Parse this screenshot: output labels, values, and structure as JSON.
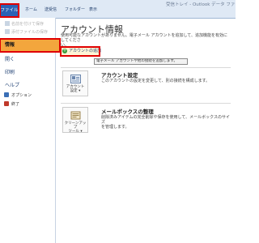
{
  "ribbon": {
    "file_tab": "ファイル",
    "tabs": [
      "ホーム",
      "送受信",
      "フォルダー",
      "表示"
    ],
    "window_title": "受信トレイ - Outlook データ ファイ"
  },
  "sidebar": {
    "commands": [
      "名前を付けて保存",
      "添付ファイルの保存"
    ],
    "nav": [
      "情報",
      "開く",
      "印刷",
      "ヘルプ"
    ],
    "options": "オプション",
    "exit": "終了"
  },
  "main": {
    "title": "アカウント情報",
    "desc_lines": [
      "使用可能なアカウントがありません。電子メール アカウントを追加して、追加機能を有効にしてくださ",
      "い。"
    ],
    "add_account": "アカウントの追加",
    "tooltip": "電子メール アカウントや他の接続を追加します。",
    "account_settings": {
      "tile_label_1": "アカウント",
      "tile_label_2": "設定 ▾",
      "title": "アカウント設定",
      "desc": "このアカウントの設定を変更して、別の接続を構成します。"
    },
    "cleanup": {
      "tile_label_1": "クリーンアップ",
      "tile_label_2": "ツール ▾",
      "title": "メールボックスの整理",
      "desc_lines": [
        "削除済みアイテムの完全削除や保存を使用して、メールボックスのサイズ",
        "を管理します。"
      ]
    }
  },
  "colors": {
    "file_tab": "#2b62b5",
    "selected_nav": "#f3a63d",
    "highlight_outline": "#e00000",
    "add_icon": "#3a9a3a"
  },
  "icons": [
    "save-as-icon",
    "attachment-icon",
    "options-icon",
    "exit-icon",
    "add-icon",
    "account-settings-icon",
    "cleanup-tools-icon"
  ]
}
